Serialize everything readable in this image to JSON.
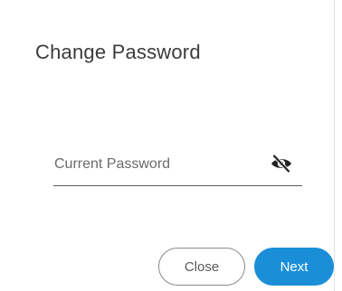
{
  "dialog": {
    "title": "Change Password",
    "current_password": {
      "placeholder": "Current Password",
      "value": "",
      "visibility_icon": "eye-slash-icon"
    },
    "buttons": {
      "close_label": "Close",
      "next_label": "Next"
    }
  },
  "colors": {
    "primary": "#1a8fd8",
    "title_text": "#3b3b3b",
    "placeholder_text": "#6b6b6b"
  }
}
